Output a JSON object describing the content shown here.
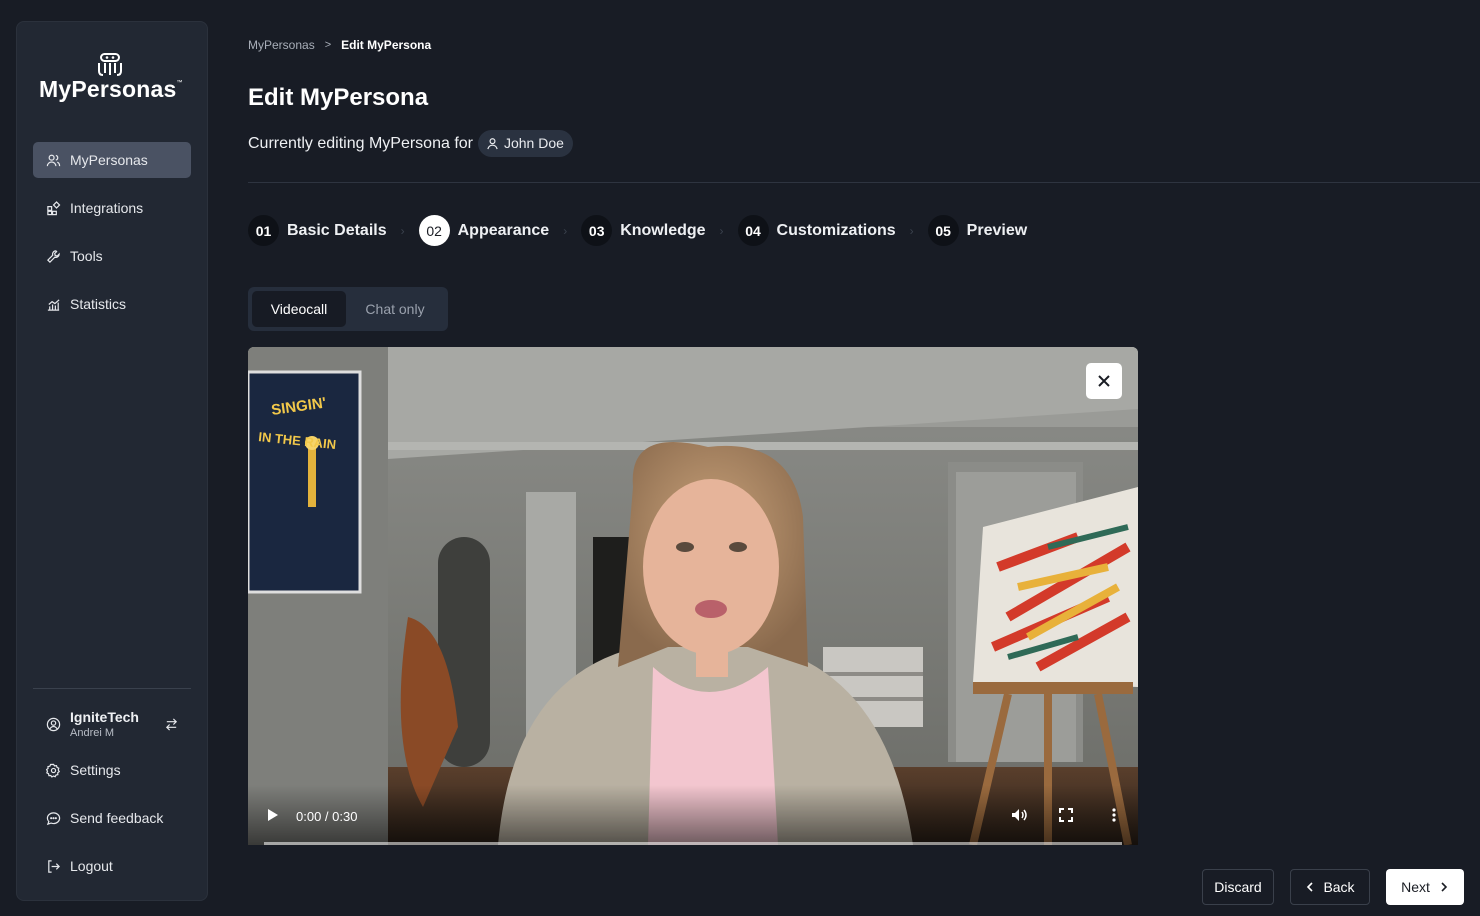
{
  "sidebar": {
    "logo_text": "MyPersonas",
    "logo_tm": "™",
    "nav": [
      {
        "label": "MyPersonas",
        "icon": "users-icon",
        "active": true
      },
      {
        "label": "Integrations",
        "icon": "integrations-icon",
        "active": false
      },
      {
        "label": "Tools",
        "icon": "wrench-icon",
        "active": false
      },
      {
        "label": "Statistics",
        "icon": "chart-icon",
        "active": false
      }
    ],
    "account": {
      "org": "IgniteTech",
      "user": "Andrei M"
    },
    "bottom_nav": [
      {
        "label": "Settings",
        "icon": "gear-icon"
      },
      {
        "label": "Send feedback",
        "icon": "chat-icon"
      },
      {
        "label": "Logout",
        "icon": "logout-icon"
      }
    ]
  },
  "breadcrumb": {
    "parent": "MyPersonas",
    "separator": ">",
    "current": "Edit MyPersona"
  },
  "page": {
    "title": "Edit MyPersona",
    "editing_prefix": "Currently editing MyPersona for",
    "user_name": "John Doe"
  },
  "steps": [
    {
      "num": "01",
      "label": "Basic Details",
      "active": false
    },
    {
      "num": "02",
      "label": "Appearance",
      "active": true
    },
    {
      "num": "03",
      "label": "Knowledge",
      "active": false
    },
    {
      "num": "04",
      "label": "Customizations",
      "active": false
    },
    {
      "num": "05",
      "label": "Preview",
      "active": false
    }
  ],
  "step_separator": "›",
  "mode_toggle": {
    "options": [
      "Videocall",
      "Chat only"
    ],
    "selected": "Videocall"
  },
  "video": {
    "time_display": "0:00 / 0:30",
    "progress": 0,
    "poster_text_line1": "SINGIN'",
    "poster_text_line2": "IN THE RAIN"
  },
  "footer": {
    "discard": "Discard",
    "back": "Back",
    "next": "Next"
  },
  "colors": {
    "background": "#181c25",
    "sidebar": "#222833",
    "active_nav": "#4a5263",
    "primary_button": "#ffffff"
  }
}
